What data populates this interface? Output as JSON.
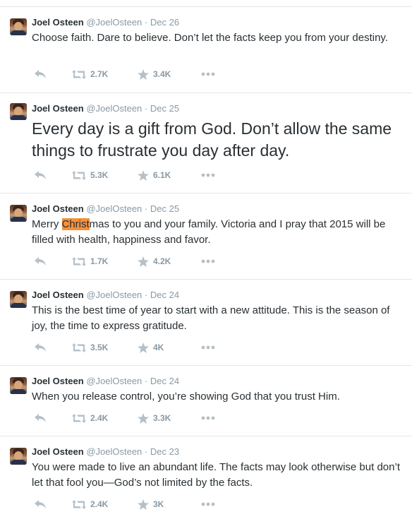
{
  "tweets": [
    {
      "name": "Joel Osteen",
      "handle": "@JoelOsteen",
      "separator": "·",
      "date": "Dec 26",
      "text": "Choose faith. Dare to believe. Don’t let the facts keep you from your destiny.",
      "retweets": "2.7K",
      "favorites": "3.4K"
    },
    {
      "name": "Joel Osteen",
      "handle": "@JoelOsteen",
      "separator": "·",
      "date": "Dec 25",
      "text": "Every day is a gift from God. Don’t allow the same things to frustrate you day after day.",
      "retweets": "5.3K",
      "favorites": "6.1K"
    },
    {
      "name": "Joel Osteen",
      "handle": "@JoelOsteen",
      "separator": "·",
      "date": "Dec 25",
      "text_before": "Merry ",
      "text_highlight": "Christ",
      "text_after": "mas to you and your family. Victoria and I pray that 2015 will be filled with health, happiness and favor.",
      "retweets": "1.7K",
      "favorites": "4.2K"
    },
    {
      "name": "Joel Osteen",
      "handle": "@JoelOsteen",
      "separator": "·",
      "date": "Dec 24",
      "text": "This is the best time of year to start with a new attitude. This is the season of joy, the time to express gratitude.",
      "retweets": "3.5K",
      "favorites": "4K"
    },
    {
      "name": "Joel Osteen",
      "handle": "@JoelOsteen",
      "separator": "·",
      "date": "Dec 24",
      "text": "When you release control, you’re showing God that you trust Him.",
      "retweets": "2.4K",
      "favorites": "3.3K"
    },
    {
      "name": "Joel Osteen",
      "handle": "@JoelOsteen",
      "separator": "·",
      "date": "Dec 23",
      "text": "You were made to live an abundant life. The facts may look otherwise but don’t let that fool you—God’s not limited by the facts.",
      "retweets": "2.4K",
      "favorites": "3K"
    }
  ],
  "icons": {
    "reply": "reply-icon",
    "retweet": "retweet-icon",
    "favorite": "star-icon",
    "more": "more-dots-icon"
  },
  "colors": {
    "text": "#292f33",
    "muted": "#8899a6",
    "divider": "#e1e8ed",
    "highlight": "#f5903b"
  }
}
